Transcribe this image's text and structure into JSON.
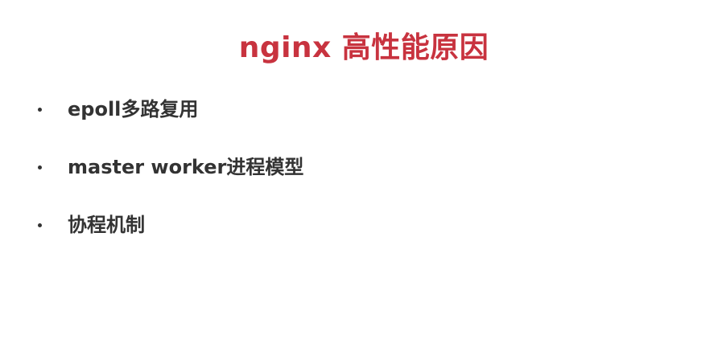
{
  "slide": {
    "title": "nginx 高性能原因",
    "colors": {
      "title": "#c8333f",
      "text": "#333333",
      "bullet": "#333333",
      "background": "#ffffff"
    },
    "bullets": [
      {
        "text": "epoll多路复用"
      },
      {
        "text": "master worker进程模型"
      },
      {
        "text": "协程机制"
      }
    ]
  }
}
